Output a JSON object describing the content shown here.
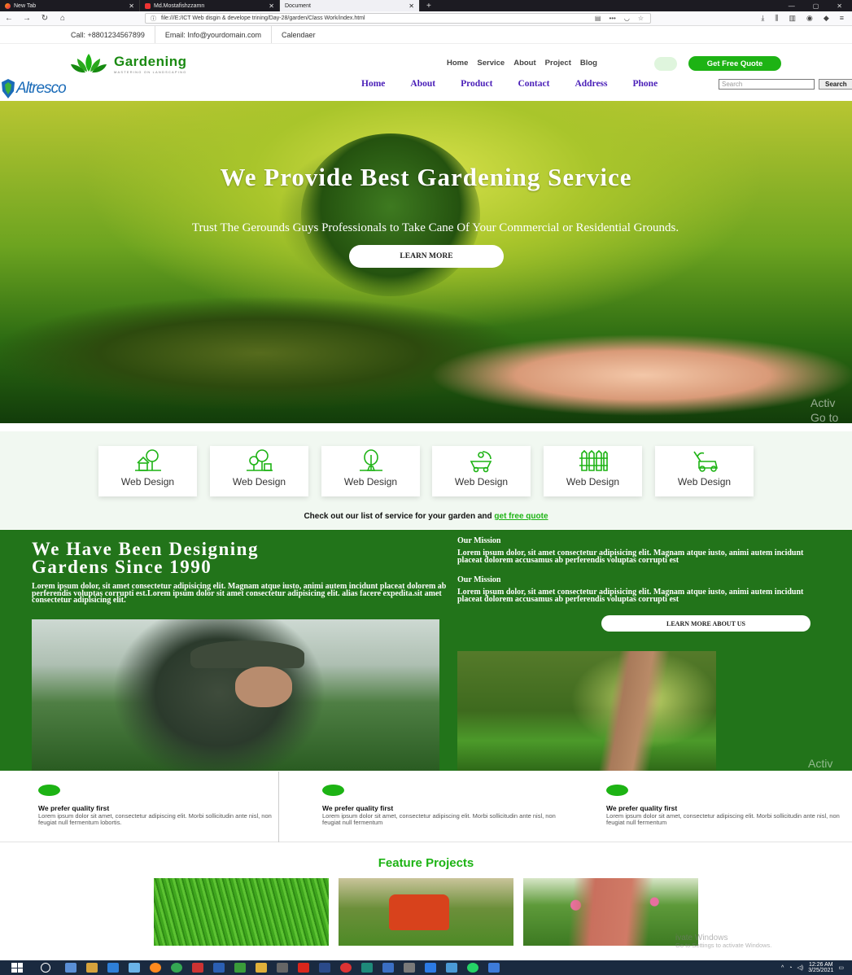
{
  "browser": {
    "tabs": [
      {
        "title": "New Tab",
        "active": false
      },
      {
        "title": "Md.Mostafishzzamn",
        "active": false
      },
      {
        "title": "Document",
        "active": true
      }
    ],
    "url": "file:///E:/ICT Web disgin & develope trining/Day-28/garden/Class Work/index.html",
    "new_tab_icon": "plus-icon"
  },
  "topbar": {
    "call": "Call: +8801234567899",
    "email": "Email: Info@yourdomain.com",
    "calendar": "Calendaer"
  },
  "header": {
    "brand_name": "Gardening",
    "brand_tagline": "MASTERING ON LANDSCAPING",
    "menu": [
      "Home",
      "Service",
      "About",
      "Project",
      "Blog"
    ],
    "quote_button": "Get Free Quote",
    "accent": "#1db314"
  },
  "secondary_nav": {
    "logo_text": "Altresco",
    "items": [
      "Home",
      "About",
      "Product",
      "Contact",
      "Address",
      "Phone"
    ],
    "search_placeholder": "Search",
    "search_button": "Search"
  },
  "hero": {
    "title": "We Provide Best Gardening Service",
    "subtitle": "Trust The Gerounds Guys Professionals to Take Cane Of Your Commercial or Residential Grounds.",
    "button": "LEARN MORE"
  },
  "watermark": {
    "line1": "Activ",
    "line2": "Go to",
    "line3": "Activ",
    "activate_title": "ivate Windows",
    "activate_sub": "Go to Settings to activate Windows."
  },
  "services": {
    "cards": [
      {
        "label": "Web Design",
        "icon": "tree-house-icon"
      },
      {
        "label": "Web Design",
        "icon": "trees-icon"
      },
      {
        "label": "Web Design",
        "icon": "tree-icon"
      },
      {
        "label": "Web Design",
        "icon": "wheelbarrow-icon"
      },
      {
        "label": "Web Design",
        "icon": "fence-icon"
      },
      {
        "label": "Web Design",
        "icon": "lawn-mower-icon"
      }
    ],
    "note": "Check out our list of service for your garden and",
    "note_link": "get free quote"
  },
  "about": {
    "title_line1": "We Have Been Designing",
    "title_line2": "Gardens Since 1990",
    "body": "Lorem ipsum dolor, sit amet consectetur adipisicing elit. Magnam atque iusto, animi autem incidunt placeat dolorem ab perferendis voluptas corrupti est.Lorem ipsum dolor sit amet consectetur adipisicing elit. alias facere expedita.sit amet consectetur adipisicing elit.",
    "missions": [
      {
        "title": "Our Mission",
        "text": "Lorem ipsum dolor, sit amet consectetur adipisicing elit. Magnam atque iusto, animi autem incidunt placeat dolorem accusamus ab perferendis voluptas corrupti est"
      },
      {
        "title": "Our Mission",
        "text": "Lorem ipsum dolor, sit amet consectetur adipisicing elit. Magnam atque iusto, animi autem incidunt placeat dolorem accusamus ab perferendis voluptas corrupti est"
      }
    ],
    "button": "LEARN MORE ABOUT US"
  },
  "quality": [
    {
      "title": "We prefer quality first",
      "text": "Lorem ipsum dolor sit amet, consectetur adipiscing elit. Morbi sollicitudin ante nisl, non feugiat null fermentum lobortis."
    },
    {
      "title": "We prefer quality first",
      "text": "Lorem ipsum dolor sit amet, consectetur adipiscing elit. Morbi sollicitudin ante nisl, non feugiat null fermentum"
    },
    {
      "title": "We prefer quality first",
      "text": "Lorem ipsum dolor sit amet, consectetur adipiscing elit. Morbi sollicitudin ante nisl, non feugiat null fermentum"
    }
  ],
  "features": {
    "title": "Feature Projects",
    "projects": [
      "grass-photo",
      "lawn-mower-photo",
      "garden-path-photo"
    ]
  },
  "taskbar": {
    "time": "12:26 AM",
    "date": "3/25/2021"
  }
}
